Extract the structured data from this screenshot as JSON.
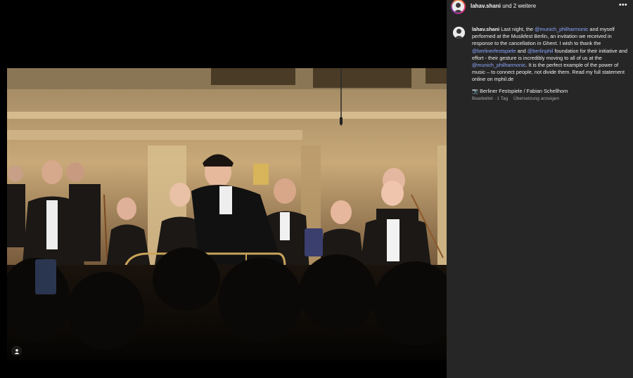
{
  "header": {
    "username": "lahav.shani",
    "others_text": " und 2 weitere",
    "more_label": "•••"
  },
  "post": {
    "caption_user": "lahav.shani",
    "caption_parts": [
      {
        "text": " Last night, the ",
        "mention": false
      },
      {
        "text": "@munich_philharmonic",
        "mention": true
      },
      {
        "text": " and myself performed at the Musikfest Berlin, an invitation we received in response to the cancellation in Ghent. I wish to thank the ",
        "mention": false
      },
      {
        "text": "@berlinerfestspiele",
        "mention": true
      },
      {
        "text": " and ",
        "mention": false
      },
      {
        "text": "@berlinphil",
        "mention": true
      },
      {
        "text": " foundation for their initiative and effort - their gesture is incredibly moving to all of us at the ",
        "mention": false
      },
      {
        "text": "@munich_philharmonic",
        "mention": true
      },
      {
        "text": ". It is the perfect example of the power of music – to connect people, not divide them. Read my full statement online on mphil.de",
        "mention": false
      }
    ],
    "credit_icon": "📷",
    "credit_text": "Berliner Festspiele / Fabian Schellhorn",
    "edited_label": "Bearbeitet",
    "time_label": "1 Tag",
    "translate_label": "Übersetzung anzeigen"
  },
  "colors": {
    "sidebar_bg": "#262626",
    "mention": "#8fa8ff",
    "meta_text": "#a8a8a8"
  },
  "icons": {
    "tag": "person-tag-icon",
    "more": "more-dots-icon"
  }
}
